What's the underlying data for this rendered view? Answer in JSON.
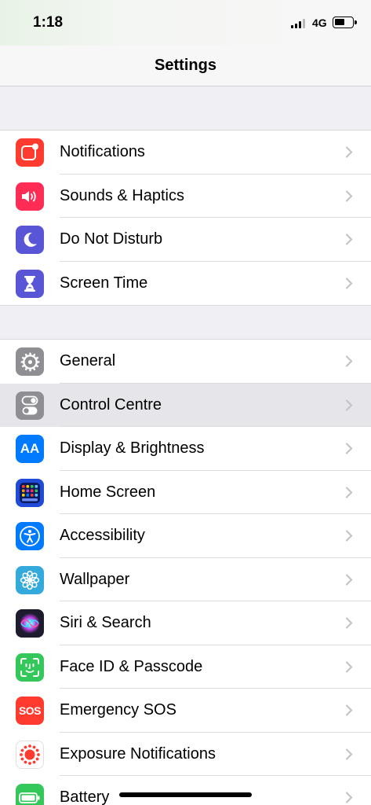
{
  "status_bar": {
    "time": "1:18",
    "network": "4G"
  },
  "nav": {
    "title": "Settings"
  },
  "groups": [
    {
      "items": [
        {
          "label": "Notifications",
          "icon": "notifications-icon",
          "color": "#ff3b30"
        },
        {
          "label": "Sounds & Haptics",
          "icon": "speaker-icon",
          "color": "#ff2d55"
        },
        {
          "label": "Do Not Disturb",
          "icon": "moon-icon",
          "color": "#5856d6"
        },
        {
          "label": "Screen Time",
          "icon": "hourglass-icon",
          "color": "#5856d6"
        }
      ]
    },
    {
      "items": [
        {
          "label": "General",
          "icon": "gear-icon",
          "color": "#8e8e93"
        },
        {
          "label": "Control Centre",
          "icon": "toggles-icon",
          "color": "#8e8e93",
          "highlighted": true
        },
        {
          "label": "Display & Brightness",
          "icon": "text-size-icon",
          "color": "#007aff",
          "icon_text": "AA"
        },
        {
          "label": "Home Screen",
          "icon": "app-grid-icon",
          "color": "#1f4bd8"
        },
        {
          "label": "Accessibility",
          "icon": "accessibility-icon",
          "color": "#007aff"
        },
        {
          "label": "Wallpaper",
          "icon": "flower-icon",
          "color": "#34aadc"
        },
        {
          "label": "Siri & Search",
          "icon": "siri-icon",
          "color": "#1c1c2e"
        },
        {
          "label": "Face ID & Passcode",
          "icon": "face-id-icon",
          "color": "#34c759"
        },
        {
          "label": "Emergency SOS",
          "icon": "sos-icon",
          "color": "#ff3b30",
          "icon_text": "SOS"
        },
        {
          "label": "Exposure Notifications",
          "icon": "exposure-icon",
          "color": "#ffffff"
        },
        {
          "label": "Battery",
          "icon": "battery-icon",
          "color": "#34c759"
        }
      ]
    }
  ]
}
